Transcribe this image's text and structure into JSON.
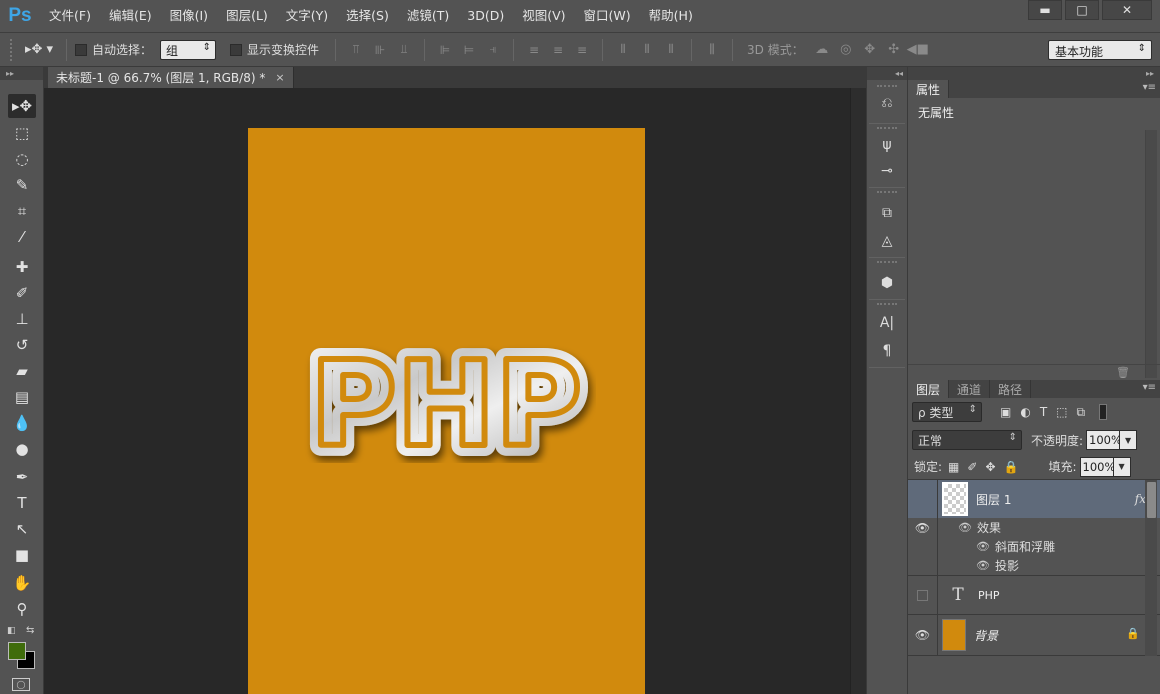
{
  "app": {
    "logo": "Ps"
  },
  "menu": [
    "文件(F)",
    "编辑(E)",
    "图像(I)",
    "图层(L)",
    "文字(Y)",
    "选择(S)",
    "滤镜(T)",
    "3D(D)",
    "视图(V)",
    "窗口(W)",
    "帮助(H)"
  ],
  "window_controls": {
    "minimize": "▬",
    "maximize": "□",
    "close": "✕"
  },
  "options": {
    "tool_icon": "move-icon",
    "auto_select_label": "自动选择：",
    "auto_select_value": "组",
    "show_transform_label": "显示变换控件",
    "mode3d_label": "3D 模式：",
    "workspace": "基本功能"
  },
  "document": {
    "tab_title": "未标题-1 @ 66.7% (图层 1, RGB/8) *",
    "close": "×",
    "background_color": "#d18a0d",
    "artwork_text": "PHP"
  },
  "colors": {
    "foreground": "#3f6c0b",
    "background": "#000000"
  },
  "properties": {
    "tab": "属性",
    "content": "无属性"
  },
  "layers_panel": {
    "tabs": [
      "图层",
      "通道",
      "路径"
    ],
    "filter_type": "ρ 类型",
    "blend_mode": "正常",
    "opacity_label": "不透明度:",
    "opacity": "100%",
    "lock_label": "锁定:",
    "fill_label": "填充:",
    "fill": "100%",
    "layers": [
      {
        "name": "图层 1",
        "fx": "fx",
        "effects_label": "效果",
        "effects": [
          "斜面和浮雕",
          "投影"
        ]
      },
      {
        "name": "PHP",
        "type_icon": "T"
      },
      {
        "name": "背景"
      }
    ]
  }
}
